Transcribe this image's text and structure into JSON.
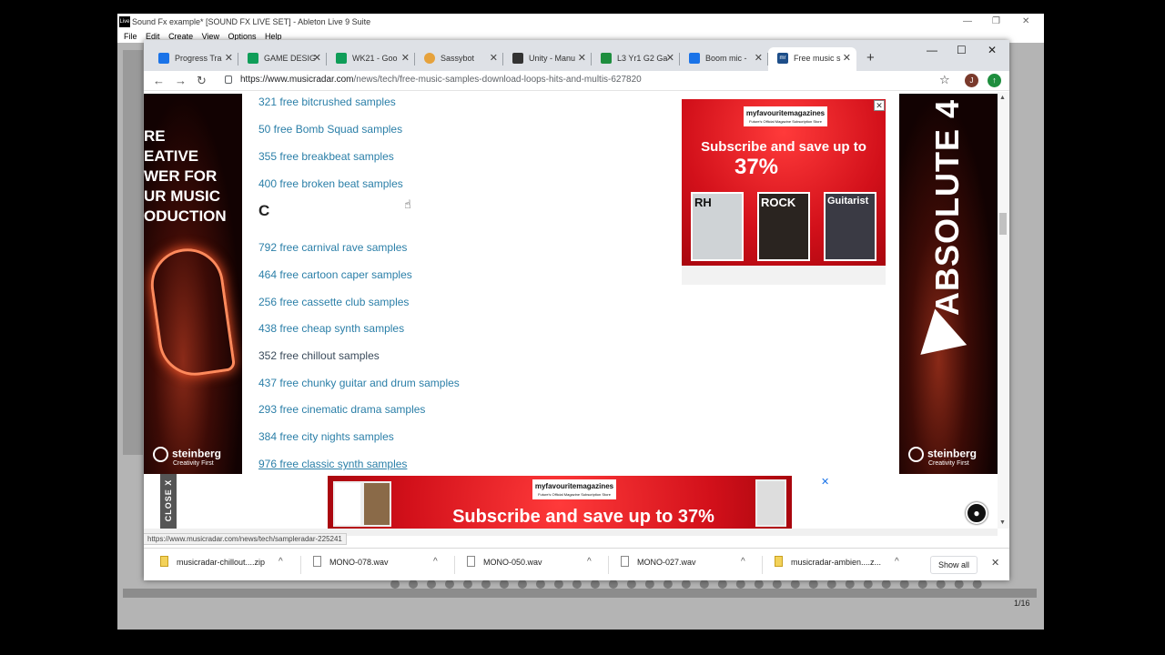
{
  "ableton": {
    "title": "Sound Fx example*  [SOUND FX LIVE SET] - Ableton Live 9 Suite",
    "logo": "Live",
    "menu": [
      "File",
      "Edit",
      "Create",
      "View",
      "Options",
      "Help"
    ],
    "bottom_counter": "1/16"
  },
  "chrome": {
    "tabs": [
      {
        "title": "Progress Tra",
        "icon_color": "#1a73e8",
        "icon": "drive-icon"
      },
      {
        "title": "GAME DESIG",
        "icon_color": "#0f9d58",
        "icon": "sheets-icon"
      },
      {
        "title": "WK21 - Goo",
        "icon_color": "#0f9d58",
        "icon": "sheets-icon"
      },
      {
        "title": "Sassybot",
        "icon_color": "#e6a23c",
        "icon": "gear-icon"
      },
      {
        "title": "Unity - Manu",
        "icon_color": "#333333",
        "icon": "unity-icon"
      },
      {
        "title": "L3 Yr1 G2 Ga",
        "icon_color": "#1e8e3e",
        "icon": "classroom-icon"
      },
      {
        "title": "Boom mic -",
        "icon_color": "#1a73e8",
        "icon": "drive-icon"
      },
      {
        "title": "Free music s",
        "icon_color": "#1d4e89",
        "icon": "musicradar-icon",
        "active": true
      }
    ],
    "url_host": "https://www.musicradar.com",
    "url_path": "/news/tech/free-music-samples-download-loops-hits-and-multis-627820",
    "avatar_letter": "J",
    "status_url": "https://www.musicradar.com/news/tech/sampleradar-225241"
  },
  "page": {
    "links_b": [
      "321 free bitcrushed samples",
      "50 free Bomb Squad samples",
      "355 free breakbeat samples",
      "400 free broken beat samples"
    ],
    "heading_c": "C",
    "links_c": [
      "792 free carnival rave samples",
      "464 free cartoon caper samples",
      "256 free cassette club samples",
      "438 free cheap synth samples",
      "352 free chillout samples",
      "437 free chunky guitar and drum samples",
      "293 free cinematic drama samples",
      "384 free city nights samples",
      "976 free classic synth samples"
    ]
  },
  "ads": {
    "left_text": "RE\nEATIVE\nWER FOR\nUR MUSIC\nODUCTION",
    "steinberg": "steinberg",
    "steinberg_tag": "Creativity First",
    "right_vertical": "ABSOLUTE 4",
    "mfm_brand": "myfavouritemagazines",
    "mfm_tagline": "Future's Official Magazine Subscription Store",
    "top_headline": "Subscribe and save up to",
    "top_percent": "37%",
    "mags": [
      "RH",
      "ROCK",
      "Guitarist"
    ],
    "bottom_headline": "Subscribe and save up to 37%",
    "close_label": "CLOSE X"
  },
  "downloads": [
    {
      "name": "musicradar-chillout....zip",
      "type": "zip"
    },
    {
      "name": "MONO-078.wav",
      "type": "file"
    },
    {
      "name": "MONO-050.wav",
      "type": "file"
    },
    {
      "name": "MONO-027.wav",
      "type": "file"
    },
    {
      "name": "musicradar-ambien....z...",
      "type": "zip"
    }
  ],
  "show_all": "Show all"
}
